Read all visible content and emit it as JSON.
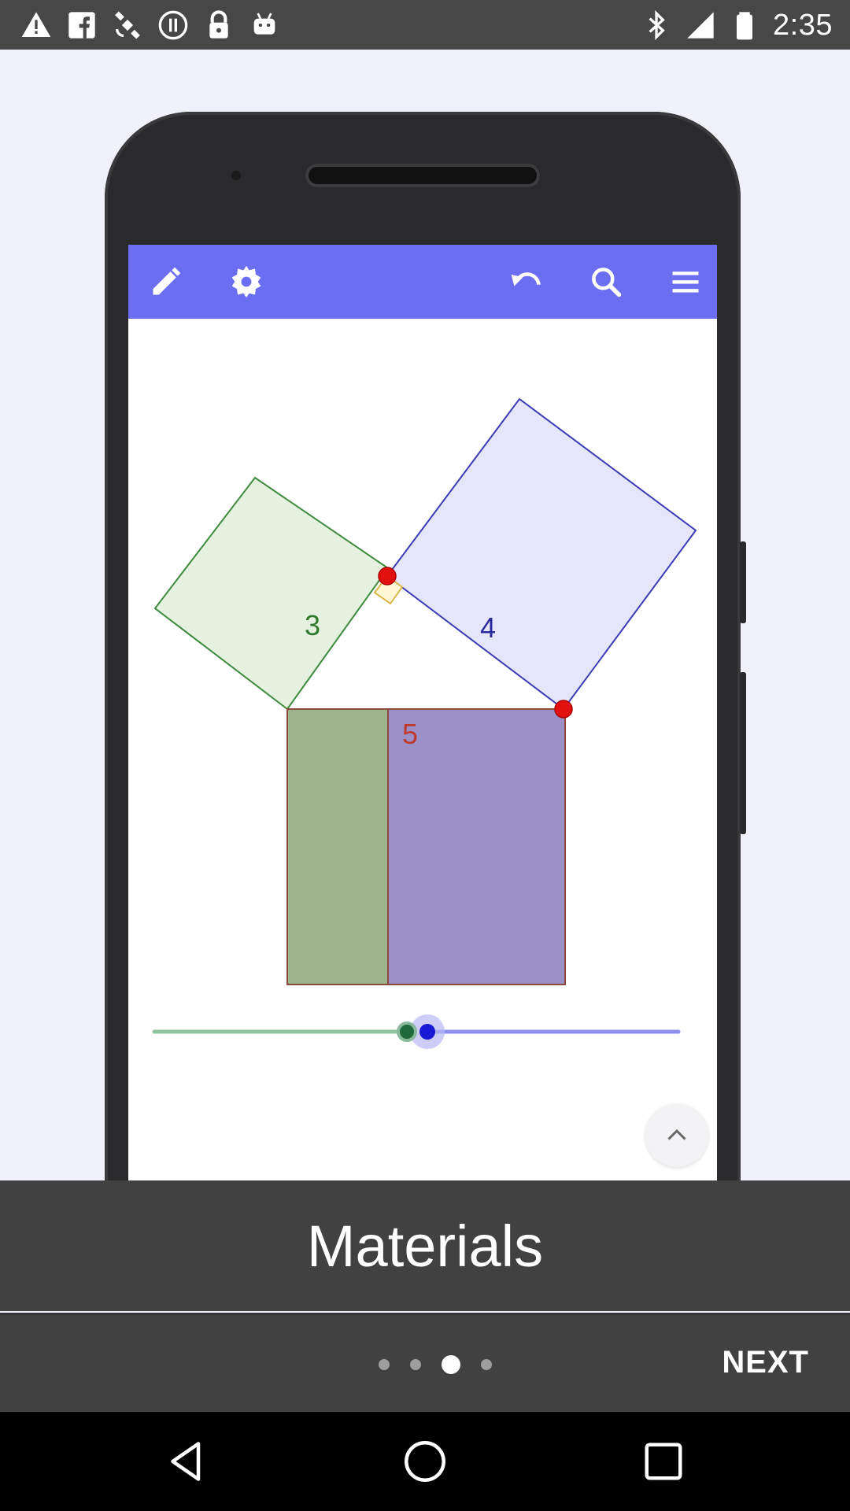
{
  "status_bar": {
    "time": "2:35",
    "left_icons": [
      "warning-icon",
      "fake-gps-facebook-icon",
      "satellite-icon",
      "info-circle-icon",
      "lock-icon",
      "android-icon"
    ],
    "right_icons": [
      "bluetooth-icon",
      "signal-icon",
      "battery-icon"
    ]
  },
  "app_preview": {
    "toolbar_icons": [
      "pencil-icon",
      "settings-icon",
      "undo-icon",
      "search-icon",
      "menu-icon"
    ],
    "toolbar_color": "#6b6ef0",
    "labels": {
      "square_small": "3",
      "square_medium": "4",
      "square_large": "5"
    },
    "colors": {
      "green": "#3f8a3f",
      "blue": "#3b3bb5",
      "red_point": "#e31010",
      "label_red": "#c0392b"
    }
  },
  "onboarding": {
    "title": "Materials",
    "page_count": 4,
    "active_page": 3,
    "next_label": "NEXT"
  }
}
